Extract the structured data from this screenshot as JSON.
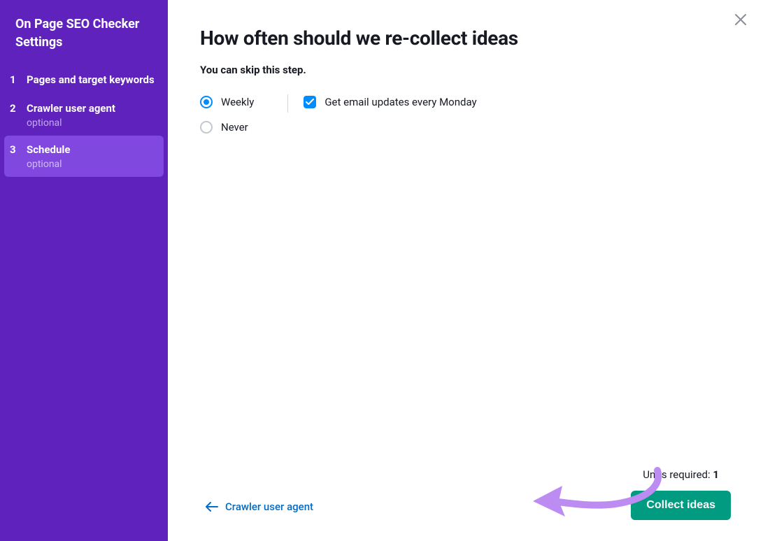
{
  "sidebar": {
    "title": "On Page SEO Checker Settings",
    "steps": [
      {
        "number": "1",
        "label": "Pages and target keywords",
        "optional": null
      },
      {
        "number": "2",
        "label": "Crawler user agent",
        "optional": "optional"
      },
      {
        "number": "3",
        "label": "Schedule",
        "optional": "optional"
      }
    ]
  },
  "main": {
    "title": "How often should we re-collect ideas",
    "subtitle": "You can skip this step.",
    "radio_weekly": "Weekly",
    "radio_never": "Never",
    "checkbox_email": "Get email updates every Monday"
  },
  "footer": {
    "back_label": "Crawler user agent",
    "units_label": "Units required: ",
    "units_value": "1",
    "collect_label": "Collect ideas"
  }
}
